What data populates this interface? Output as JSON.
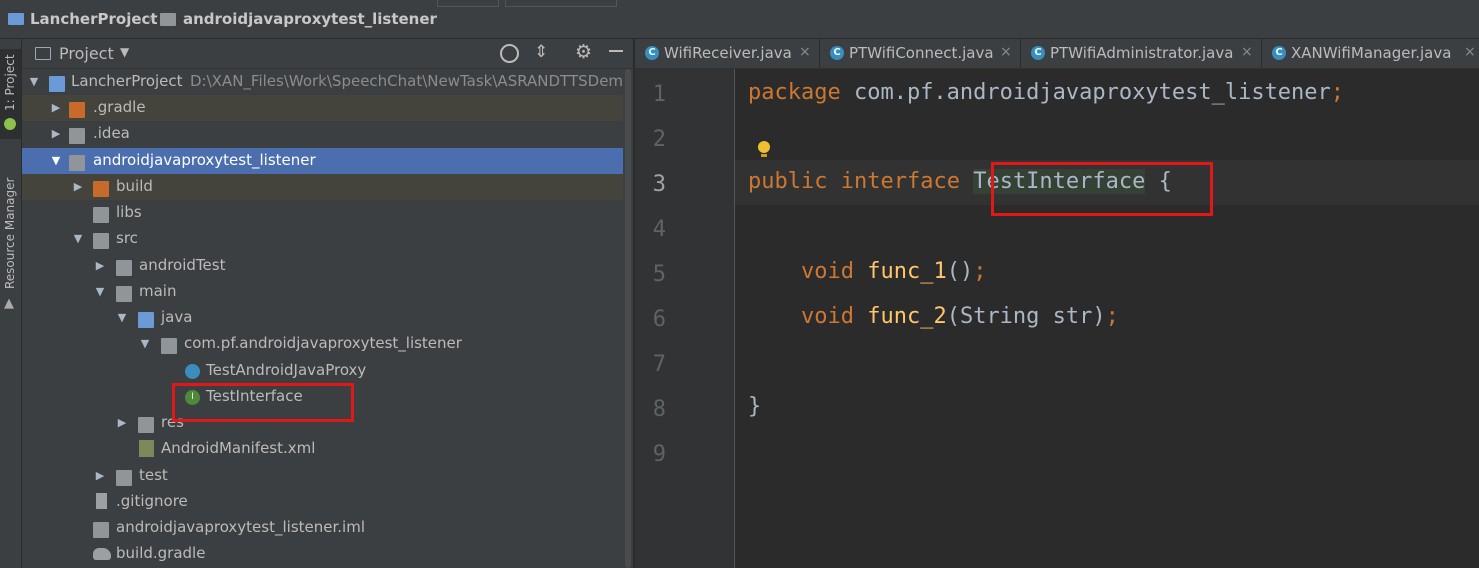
{
  "breadcrumb": {
    "project": "LancherProject",
    "module": "androidjavaproxytest_listener"
  },
  "leftstrip": {
    "project_tab": "1: Project",
    "resource_tab": "Resource Manager"
  },
  "project_panel": {
    "title": "Project",
    "dropdown_icon": "chevron-down-icon",
    "tools": [
      "target-icon",
      "collapse-icon",
      "gear-icon",
      "hide-icon"
    ]
  },
  "tree": [
    {
      "label": "LancherProject",
      "path": "D:\\XAN_Files\\Work\\SpeechChat\\NewTask\\ASRANDTTSDemo",
      "icon": "project-icon",
      "expanded": true,
      "depth": 0
    },
    {
      "label": ".gradle",
      "icon": "folder-orange-icon",
      "expanded": false,
      "depth": 1
    },
    {
      "label": ".idea",
      "icon": "folder-icon",
      "expanded": false,
      "depth": 1
    },
    {
      "label": "androidjavaproxytest_listener",
      "icon": "module-icon",
      "expanded": true,
      "depth": 1,
      "selected": true
    },
    {
      "label": "build",
      "icon": "folder-orange-icon",
      "expanded": false,
      "depth": 2
    },
    {
      "label": "libs",
      "icon": "folder-icon",
      "depth": 2
    },
    {
      "label": "src",
      "icon": "folder-icon",
      "expanded": true,
      "depth": 2
    },
    {
      "label": "androidTest",
      "icon": "folder-icon",
      "expanded": false,
      "depth": 3
    },
    {
      "label": "main",
      "icon": "folder-icon",
      "expanded": true,
      "depth": 3
    },
    {
      "label": "java",
      "icon": "folder-blue-icon",
      "expanded": true,
      "depth": 4
    },
    {
      "label": "com.pf.androidjavaproxytest_listener",
      "icon": "package-icon",
      "expanded": true,
      "depth": 5
    },
    {
      "label": "TestAndroidJavaProxy",
      "icon": "class-icon",
      "depth": 6
    },
    {
      "label": "TestInterface",
      "icon": "interface-icon",
      "depth": 6
    },
    {
      "label": "res",
      "icon": "folder-icon",
      "expanded": false,
      "depth": 4
    },
    {
      "label": "AndroidManifest.xml",
      "icon": "manifest-icon",
      "depth": 4
    },
    {
      "label": "test",
      "icon": "folder-icon",
      "expanded": false,
      "depth": 3
    },
    {
      "label": ".gitignore",
      "icon": "file-icon",
      "depth": 2
    },
    {
      "label": "androidjavaproxytest_listener.iml",
      "icon": "module-file-icon",
      "depth": 2
    },
    {
      "label": "build.gradle",
      "icon": "gradle-icon",
      "depth": 2
    }
  ],
  "tabs": [
    {
      "label": "WifiReceiver.java",
      "icon_letter": "C"
    },
    {
      "label": "PTWifiConnect.java",
      "icon_letter": "C"
    },
    {
      "label": "PTWifiAdministrator.java",
      "icon_letter": "C"
    },
    {
      "label": "XANWifiManager.java",
      "icon_letter": "C"
    }
  ],
  "tab_close_glyph": "×",
  "interface_icon_letter": "I",
  "editor": {
    "line_numbers": [
      "1",
      "2",
      "3",
      "4",
      "5",
      "6",
      "7",
      "8",
      "9"
    ],
    "line1": {
      "kw": "package",
      "rest": " com.pf.androidjavaproxytest_listener",
      "semi": ";"
    },
    "line3": {
      "kw1": "public",
      "kw2": "interface",
      "name": "TestInterface",
      "brace": " {"
    },
    "line5": {
      "indent": "    ",
      "kw": "void",
      "fn": "func_1",
      "args": "()",
      "semi": ";"
    },
    "line6": {
      "indent": "    ",
      "kw": "void",
      "fn": "func_2",
      "args": "(String str)",
      "semi": ";"
    },
    "line8": {
      "text": "}"
    }
  },
  "colors": {
    "highlight_box": "#e01818",
    "selection": "#4b6eaf",
    "keyword": "#cc7832",
    "function": "#ffc66d"
  }
}
